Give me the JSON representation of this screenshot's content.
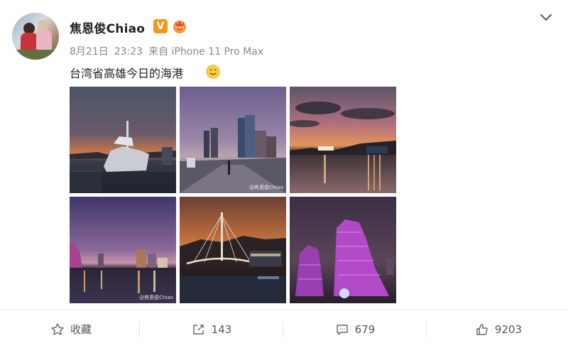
{
  "post": {
    "username": "焦恩俊Chiao",
    "verified_badge": "V",
    "date": "8月21日",
    "time": "23:23",
    "source": "来自 iPhone 11 Pro Max",
    "text": "台湾省高雄今日的海港",
    "emoji": "smile-emoji"
  },
  "photos": [
    {
      "name": "photo-harbor-yacht-sunset",
      "watermark": ""
    },
    {
      "name": "photo-waterfront-promenade-skyscrapers",
      "watermark": "@焦恩俊Chiao"
    },
    {
      "name": "photo-harbor-sunset-clouds",
      "watermark": ""
    },
    {
      "name": "photo-purple-dusk-waterfront",
      "watermark": "@焦恩俊Chiao"
    },
    {
      "name": "photo-bridge-harbor-night",
      "watermark": ""
    },
    {
      "name": "photo-music-center-night",
      "watermark": ""
    }
  ],
  "actions": {
    "favorite_label": "收藏",
    "repost_count": "143",
    "comment_count": "679",
    "like_count": "9203"
  },
  "colors": {
    "badge_orange": "#f19a1a",
    "text_primary": "#222222",
    "text_meta": "#888888"
  }
}
